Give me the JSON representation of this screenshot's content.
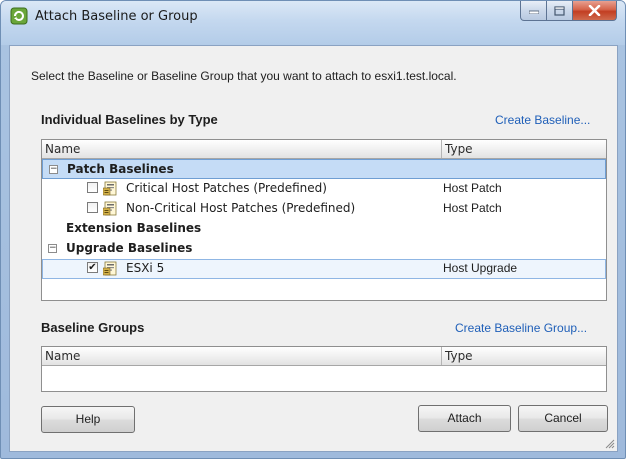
{
  "window": {
    "title": "Attach Baseline or Group",
    "icon": "vmware-update-manager-icon",
    "controls": [
      "minimize-icon",
      "maximize-icon",
      "close-icon"
    ]
  },
  "instruction": "Select the Baseline or Baseline Group that you want to attach to esxi1.test.local.",
  "individual": {
    "title": "Individual Baselines by Type",
    "create_link": "Create Baseline...",
    "columns": {
      "name": "Name",
      "type": "Type"
    },
    "groups": [
      {
        "label": "Patch Baselines",
        "expander": "−",
        "items": [
          {
            "label": "Critical Host Patches (Predefined)",
            "type": "Host Patch",
            "checked": ""
          },
          {
            "label": "Non-Critical Host Patches (Predefined)",
            "type": "Host Patch",
            "checked": ""
          }
        ]
      },
      {
        "label": "Extension Baselines",
        "expander": "",
        "items": []
      },
      {
        "label": "Upgrade Baselines",
        "expander": "−",
        "items": [
          {
            "label": "ESXi 5",
            "type": "Host Upgrade",
            "checked": "✔"
          }
        ]
      }
    ]
  },
  "groups_section": {
    "title": "Baseline Groups",
    "create_link": "Create Baseline Group...",
    "columns": {
      "name": "Name",
      "type": "Type"
    }
  },
  "buttons": {
    "help": "Help",
    "attach": "Attach",
    "cancel": "Cancel"
  },
  "colors": {
    "link": "#1f5fb8",
    "selection": "#c5dcf6",
    "close_button": "#c23e22"
  }
}
